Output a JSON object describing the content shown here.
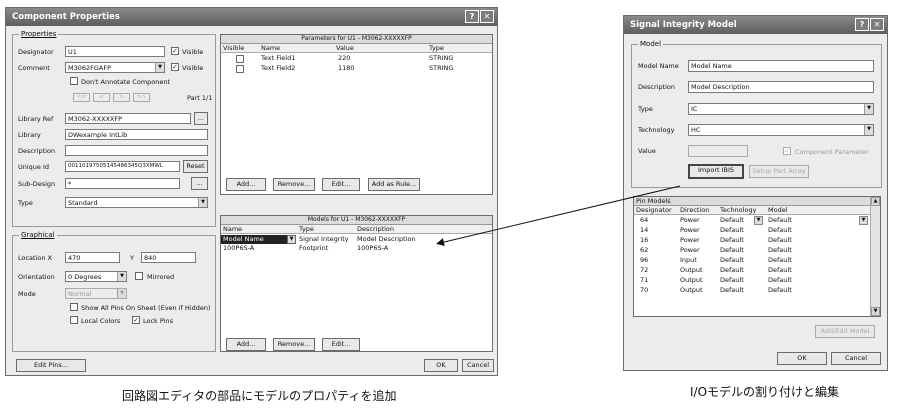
{
  "comp": {
    "title": "Component Properties",
    "props": {
      "label": "Properties",
      "designator_label": "Designator",
      "designator_value": "U1",
      "visible1": "Visible",
      "comment_label": "Comment",
      "comment_value": "M3062FGAFP",
      "visible2": "Visible",
      "dont_annotate": "Don't Annotate Component",
      "nav": [
        "<<",
        "<",
        ">",
        ">>"
      ],
      "part": "Part 1/1",
      "libref_label": "Library Ref",
      "libref_value": "M3062-XXXXXFP",
      "library_label": "Library",
      "library_value": "DWexample IntLib",
      "description_label": "Description",
      "uniqueid_label": "Unique Id",
      "uniqueid_value": "00110197505145486345Q3XMWL",
      "reset": "Reset",
      "subdesign_label": "Sub-Design",
      "subdesign_value": "*",
      "browse": "...",
      "type_label": "Type",
      "type_value": "Standard"
    },
    "graph": {
      "label": "Graphical",
      "locx_label": "Location X",
      "locx_value": "470",
      "y_label": "Y",
      "y_value": "840",
      "orient_label": "Orientation",
      "orient_value": "0 Degrees",
      "mirrored": "Mirrored",
      "mode_label": "Mode",
      "mode_value": "Normal",
      "show_pins": "Show All Pins On Sheet (Even if Hidden)",
      "local_colors": "Local Colors",
      "lock_pins": "Lock Pins"
    },
    "params": {
      "title": "Parameters for U1 - M3062-XXXXXFP",
      "cols": [
        "Visible",
        "Name",
        "Value",
        "Type"
      ],
      "rows": [
        {
          "name": "Text Field1",
          "value": "220",
          "type": "STRING"
        },
        {
          "name": "Text Field2",
          "value": "1180",
          "type": "STRING"
        }
      ],
      "buttons": [
        "Add...",
        "Remove...",
        "Edit...",
        "Add as Rule..."
      ]
    },
    "models": {
      "title": "Models for U1 - M3062-XXXXXFP",
      "cols": [
        "Name",
        "Type",
        "Description"
      ],
      "rows": [
        {
          "name": "Model Name",
          "type": "Signal Integrity",
          "desc": "Model Description"
        },
        {
          "name": "100P6S-A",
          "type": "Footprint",
          "desc": "100P6S-A"
        }
      ],
      "buttons": [
        "Add...",
        "Remove...",
        "Edit..."
      ]
    },
    "edit_pins": "Edit Pins...",
    "ok": "OK",
    "cancel": "Cancel"
  },
  "si": {
    "title": "Signal Integrity Model",
    "model_group": "Model",
    "modelname_label": "Model Name",
    "modelname_value": "Model Name",
    "desc_label": "Description",
    "desc_value": "Model Description",
    "type_label": "Type",
    "type_value": "IC",
    "tech_label": "Technology",
    "tech_value": "HC",
    "value_label": "Value",
    "comp_param": "Component Parameter",
    "import": "Import IBIS",
    "setup": "Setup Part Array",
    "pin_title": "Pin Models",
    "pin_cols": [
      "Designator",
      "Direction",
      "Technology",
      "Model"
    ],
    "pins": [
      [
        "64",
        "Power",
        "Default",
        "Default"
      ],
      [
        "14",
        "Power",
        "Default",
        "Default"
      ],
      [
        "16",
        "Power",
        "Default",
        "Default"
      ],
      [
        "62",
        "Power",
        "Default",
        "Default"
      ],
      [
        "96",
        "Input",
        "Default",
        "Default"
      ],
      [
        "72",
        "Output",
        "Default",
        "Default"
      ],
      [
        "71",
        "Output",
        "Default",
        "Default"
      ],
      [
        "70",
        "Output",
        "Default",
        "Default"
      ]
    ],
    "add_edit": "Add/Edit Model",
    "ok": "OK",
    "cancel": "Cancel"
  },
  "captions": {
    "left": "回路図エディタの部品にモデルのプロパティを追加",
    "right": "I/Oモデルの割り付けと編集"
  },
  "colors": {
    "titlebar": "#6f6f6f",
    "dialog": "#ececec",
    "selection": "#222222"
  }
}
